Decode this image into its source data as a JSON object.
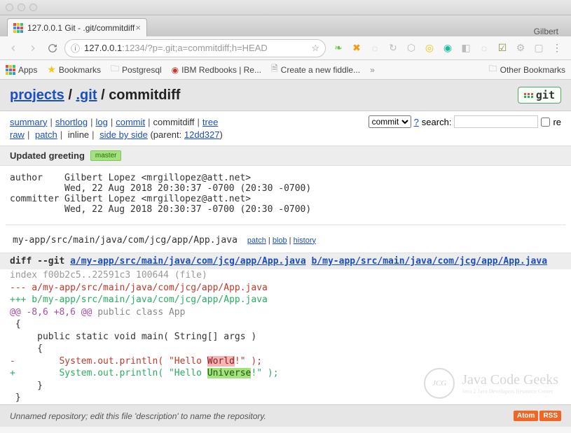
{
  "browser": {
    "profile": "Gilbert",
    "tab_title": "127.0.0.1 Git - .git/commitdiff",
    "url_host": "127.0.0.1",
    "url_port": ":1234",
    "url_path": "/?p=.git;a=commitdiff;h=HEAD",
    "bookmarks": {
      "apps": "Apps",
      "bookmarks": "Bookmarks",
      "postgresql": "Postgresql",
      "ibm": "IBM Redbooks | Re...",
      "fiddle": "Create a new fiddle...",
      "other": "Other Bookmarks"
    }
  },
  "header": {
    "projects": "projects",
    "repo": ".git",
    "page": "commitdiff",
    "git_label": "git"
  },
  "nav": {
    "summary": "summary",
    "shortlog": "shortlog",
    "log": "log",
    "commit": "commit",
    "commitdiff": "commitdiff",
    "tree": "tree",
    "raw": "raw",
    "patch": "patch",
    "inline": "inline",
    "sbs": "side by side",
    "parent_label": "(parent:",
    "parent_hash": "12dd327",
    "parent_close": ")"
  },
  "search": {
    "type": "commit",
    "help": "?",
    "label": "search:",
    "re": "re",
    "value": ""
  },
  "commit": {
    "title": "Updated greeting",
    "badge": "master",
    "author_label": "author",
    "author_name": "Gilbert Lopez <mrgillopez@att.net>",
    "author_date": "Wed, 22 Aug 2018 20:30:37 -0700 (20:30 -0700)",
    "committer_label": "committer",
    "committer_name": "Gilbert Lopez <mrgillopez@att.net>",
    "committer_date": "Wed, 22 Aug 2018 20:30:37 -0700 (20:30 -0700)"
  },
  "file": {
    "path": "my-app/src/main/java/com/jcg/app/App.java",
    "link_patch": "patch",
    "link_blob": "blob",
    "link_history": "history"
  },
  "diff": {
    "cmd": "diff --git",
    "a_path": "a/my-app/src/main/java/com/jcg/app/App.java",
    "b_path": "b/my-app/src/main/java/com/jcg/app/App.java",
    "index": "index f00b2c5..22591c3 100644",
    "file_mode": "(file)",
    "minus": "--- a/my-app/src/main/java/com/jcg/app/App.java",
    "plus": "+++ b/my-app/src/main/java/com/jcg/app/App.java",
    "hunk": "@@ -8,6 +8,6 @@",
    "hunk_ctx": " public class App",
    "l1": " {",
    "l2": "     public static void main( String[] args )",
    "l3": "     {",
    "del_pre": "-        System.out.println( \"Hello ",
    "del_word": "World",
    "del_post": "!\" );",
    "add_pre": "+        System.out.println( \"Hello ",
    "add_word": "Universe",
    "add_post": "!\" );",
    "l4": "     }",
    "l5": " }"
  },
  "watermark": {
    "circ": "JCG",
    "main": "Java Code Geeks",
    "sub": "Java 2 Java Developers Resource Center"
  },
  "footer": {
    "text": "Unnamed repository; edit this file 'description' to name the repository.",
    "atom": "Atom",
    "rss": "RSS"
  }
}
